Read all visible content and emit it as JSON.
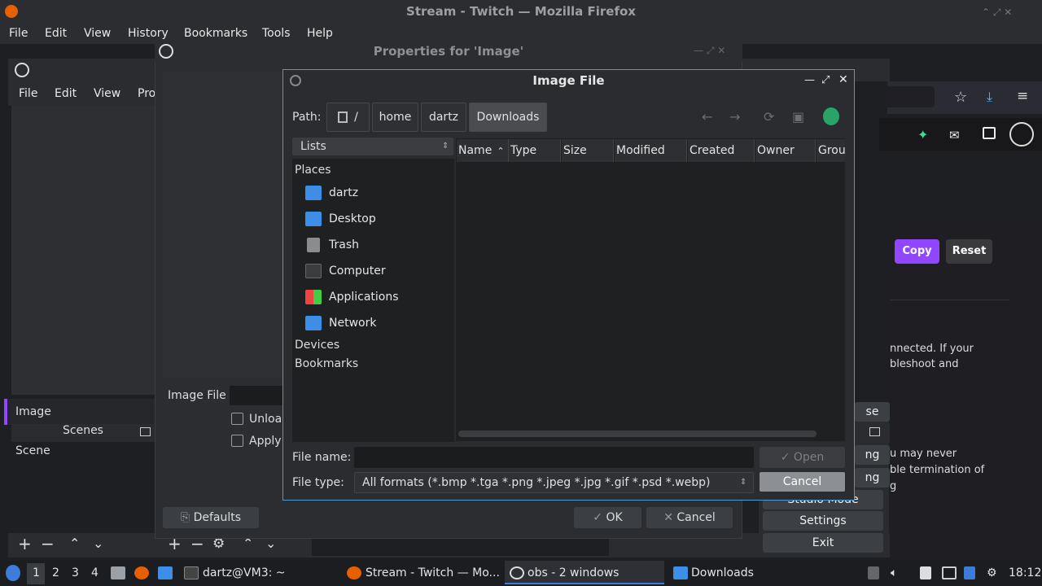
{
  "firefox": {
    "title": "Stream - Twitch — Mozilla Firefox",
    "menu": [
      "File",
      "Edit",
      "View",
      "History",
      "Bookmarks",
      "Tools",
      "Help"
    ],
    "twitch": {
      "copy_label": "Copy",
      "reset_label": "Reset",
      "text1": "nnected. If your",
      "text2": "bleshoot and",
      "text3": "u may never",
      "text4": "ble termination of",
      "text5": "g",
      "accent": "#9147ff"
    }
  },
  "obs": {
    "menu": [
      "File",
      "Edit",
      "View",
      "Pro"
    ],
    "source_item": "Image",
    "scenes_header": "Scenes",
    "scene_item": "Scene",
    "controls": [
      "se",
      "ng",
      "ng",
      "Studio Mode",
      "Settings",
      "Exit"
    ]
  },
  "properties": {
    "title": "Properties for 'Image'",
    "image_file_label": "Image File",
    "unload_label": "Unloa",
    "apply_label": "Apply",
    "defaults_label": "Defaults",
    "ok_label": "OK",
    "cancel_label": "Cancel"
  },
  "dialog": {
    "title": "Image File",
    "path_label": "Path:",
    "crumbs": [
      "/",
      "home",
      "dartz",
      "Downloads"
    ],
    "lists_label": "Lists",
    "places_header": "Places",
    "places": [
      "dartz",
      "Desktop",
      "Trash",
      "Computer",
      "Applications",
      "Network"
    ],
    "devices_header": "Devices",
    "bookmarks_header": "Bookmarks",
    "columns": [
      "Name",
      "Type",
      "Size",
      "Modified",
      "Created",
      "Owner",
      "Grou"
    ],
    "file_name_label": "File name:",
    "file_name_value": "",
    "open_label": "Open",
    "file_type_label": "File type:",
    "file_type_value": "All formats (*.bmp *.tga *.png *.jpeg *.jpg *.gif *.psd *.webp)",
    "cancel_label": "Cancel",
    "border_color": "#4a9ad8"
  },
  "taskbar": {
    "workspaces": [
      "1",
      "2",
      "3",
      "4"
    ],
    "terminal": "dartz@VM3: ~",
    "firefox": "Stream - Twitch — Mo...",
    "obs": "obs - 2 windows",
    "files": "Downloads",
    "clock": "18:12"
  }
}
